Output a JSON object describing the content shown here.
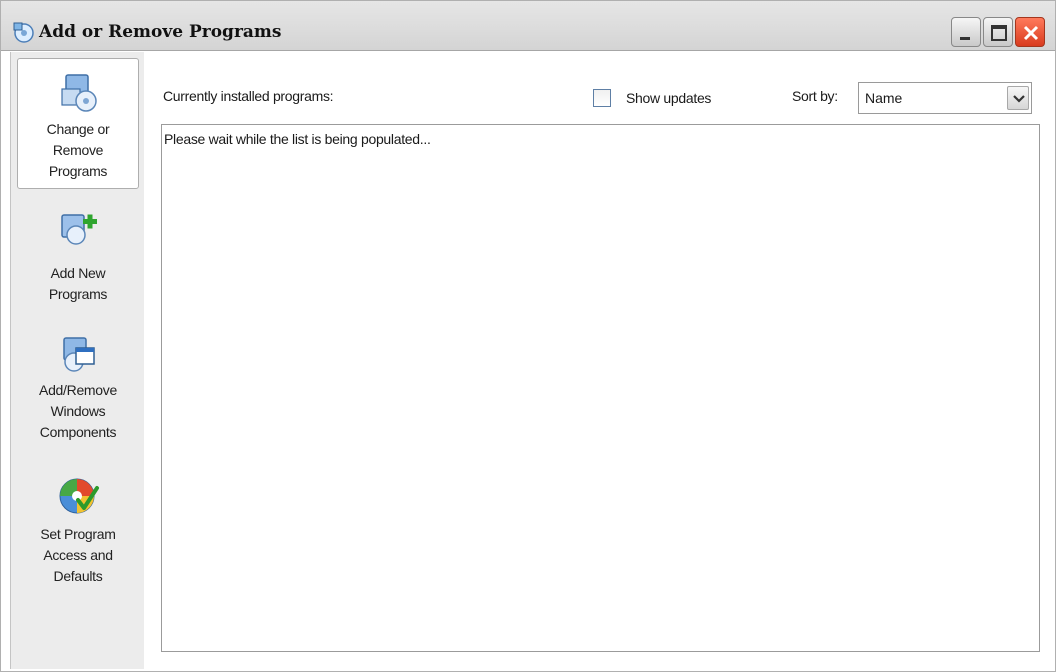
{
  "window": {
    "title": "Add or Remove Programs",
    "controls": [
      "minimize-icon",
      "maximize-icon",
      "close-icon"
    ]
  },
  "sidebar": {
    "items": [
      {
        "icon": "change-remove-programs-icon",
        "line1": "Change or",
        "line2": "Remove",
        "line3": "Programs",
        "selected": true
      },
      {
        "icon": "add-new-programs-icon",
        "line1": "Add New",
        "line2": "Programs",
        "line3": "",
        "selected": false
      },
      {
        "icon": "windows-components-icon",
        "line1": "Add/Remove",
        "line2": "Windows",
        "line3": "Components",
        "selected": false
      },
      {
        "icon": "program-access-defaults-icon",
        "line1": "Set Program",
        "line2": "Access and",
        "line3": "Defaults",
        "selected": false
      }
    ]
  },
  "main": {
    "installed_label": "Currently installed programs:",
    "show_updates_label": "Show updates",
    "show_updates_checked": false,
    "sort_label": "Sort by:",
    "sort_value": "Name",
    "list_message": "Please wait while the list is being populated..."
  },
  "colors": {
    "titlebar": "#dcdcdc",
    "sidebar": "#ececec",
    "close_button": "#e0502f",
    "window_border": "#b0b0b0"
  }
}
